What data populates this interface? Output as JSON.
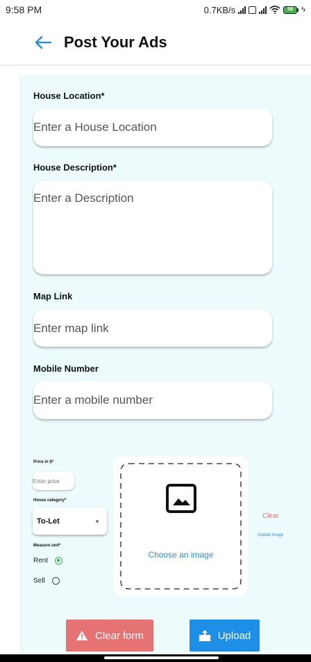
{
  "status_bar": {
    "time": "9:58 PM",
    "net_speed": "0.7KB/s",
    "battery": "58"
  },
  "app_bar": {
    "title": "Post Your Ads",
    "back_icon": "arrow-left-icon"
  },
  "form": {
    "location": {
      "label": "House Location*",
      "placeholder": "Enter a House Location"
    },
    "description": {
      "label": "House Description*",
      "placeholder": "Enter a Description"
    },
    "map": {
      "label": "Map Link",
      "placeholder": "Enter map link"
    },
    "mobile": {
      "label": "Mobile Number",
      "placeholder": "Enter a mobile number"
    },
    "price": {
      "label": "Price in $*",
      "placeholder": "Enter price"
    },
    "category": {
      "label": "House category*",
      "selected": "To-Let"
    },
    "measure": {
      "label": "Measure unit*",
      "options": [
        {
          "label": "Rent",
          "checked": true
        },
        {
          "label": "Sell",
          "checked": false
        }
      ]
    },
    "image": {
      "choose_label": "Choose an image",
      "icon": "image-icon"
    },
    "clear_link": "Clear",
    "update_link": "Update image"
  },
  "buttons": {
    "clear_form": "Clear form",
    "upload": "Upload"
  },
  "colors": {
    "accent_blue": "#1e8fe6",
    "clear_red": "#e57373",
    "panel_bg": "#eefbfc",
    "radio_green": "#2fae4a"
  }
}
